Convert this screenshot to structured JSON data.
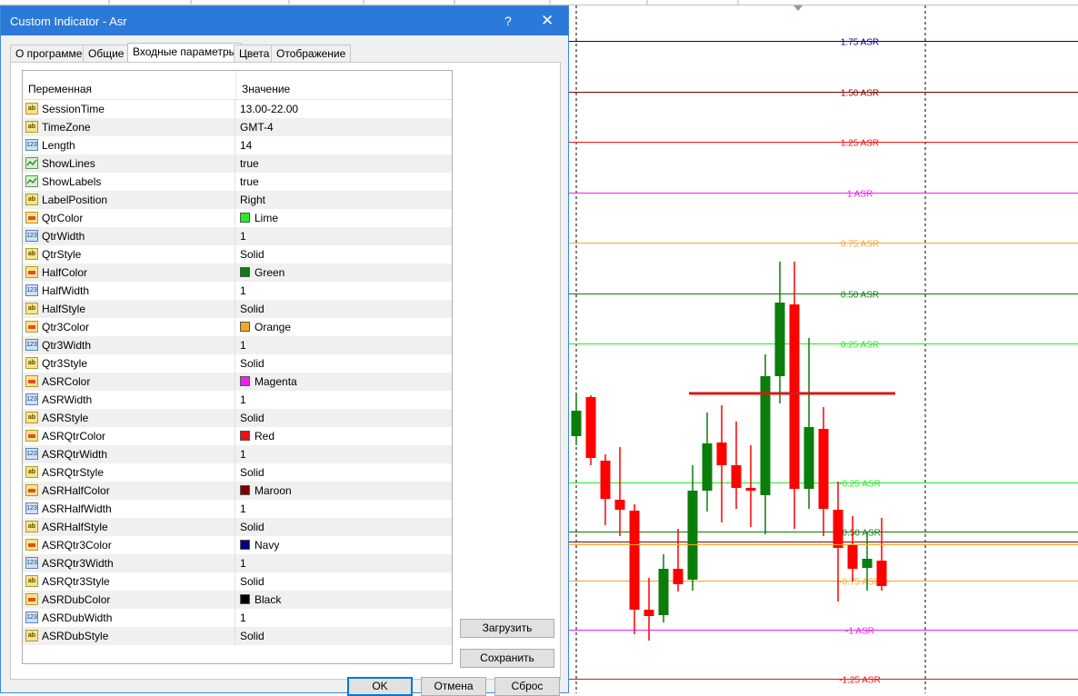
{
  "window": {
    "title": "Custom Indicator - Asr",
    "help_label": "?",
    "close_label": "✕"
  },
  "tabs": [
    {
      "label": "О программе",
      "active": false
    },
    {
      "label": "Общие",
      "active": false
    },
    {
      "label": "Входные параметры",
      "active": true
    },
    {
      "label": "Цвета",
      "active": false
    },
    {
      "label": "Отображение",
      "active": false
    }
  ],
  "params": {
    "columns": {
      "name": "Переменная",
      "value": "Значение"
    },
    "rows": [
      {
        "type": "ab",
        "name": "SessionTime",
        "value": "13.00-22.00"
      },
      {
        "type": "ab",
        "name": "TimeZone",
        "value": "GMT-4"
      },
      {
        "type": "num",
        "name": "Length",
        "value": "14"
      },
      {
        "type": "bool",
        "name": "ShowLines",
        "value": "true"
      },
      {
        "type": "bool",
        "name": "ShowLabels",
        "value": "true"
      },
      {
        "type": "ab",
        "name": "LabelPosition",
        "value": "Right"
      },
      {
        "type": "color",
        "name": "QtrColor",
        "value": "Lime",
        "swatch": "#22ee22"
      },
      {
        "type": "num",
        "name": "QtrWidth",
        "value": "1"
      },
      {
        "type": "ab",
        "name": "QtrStyle",
        "value": "Solid"
      },
      {
        "type": "color",
        "name": "HalfColor",
        "value": "Green",
        "swatch": "#0a7d0a"
      },
      {
        "type": "num",
        "name": "HalfWidth",
        "value": "1"
      },
      {
        "type": "ab",
        "name": "HalfStyle",
        "value": "Solid"
      },
      {
        "type": "color",
        "name": "Qtr3Color",
        "value": "Orange",
        "swatch": "#f5a623"
      },
      {
        "type": "num",
        "name": "Qtr3Width",
        "value": "1"
      },
      {
        "type": "ab",
        "name": "Qtr3Style",
        "value": "Solid"
      },
      {
        "type": "color",
        "name": "ASRColor",
        "value": "Magenta",
        "swatch": "#ee22ee"
      },
      {
        "type": "num",
        "name": "ASRWidth",
        "value": "1"
      },
      {
        "type": "ab",
        "name": "ASRStyle",
        "value": "Solid"
      },
      {
        "type": "color",
        "name": "ASRQtrColor",
        "value": "Red",
        "swatch": "#ee1111"
      },
      {
        "type": "num",
        "name": "ASRQtrWidth",
        "value": "1"
      },
      {
        "type": "ab",
        "name": "ASRQtrStyle",
        "value": "Solid"
      },
      {
        "type": "color",
        "name": "ASRHalfColor",
        "value": "Maroon",
        "swatch": "#800000"
      },
      {
        "type": "num",
        "name": "ASRHalfWidth",
        "value": "1"
      },
      {
        "type": "ab",
        "name": "ASRHalfStyle",
        "value": "Solid"
      },
      {
        "type": "color",
        "name": "ASRQtr3Color",
        "value": "Navy",
        "swatch": "#000080"
      },
      {
        "type": "num",
        "name": "ASRQtr3Width",
        "value": "1"
      },
      {
        "type": "ab",
        "name": "ASRQtr3Style",
        "value": "Solid"
      },
      {
        "type": "color",
        "name": "ASRDubColor",
        "value": "Black",
        "swatch": "#000000"
      },
      {
        "type": "num",
        "name": "ASRDubWidth",
        "value": "1"
      },
      {
        "type": "ab",
        "name": "ASRDubStyle",
        "value": "Solid"
      }
    ]
  },
  "buttons": {
    "load": "Загрузить",
    "save": "Сохранить",
    "ok": "OK",
    "cancel": "Отмена",
    "reset": "Сброс"
  },
  "icon_text": {
    "ab": "ab",
    "num": "123"
  },
  "chart": {
    "levels": [
      {
        "label": "1.75 ASR",
        "color": "#000080"
      },
      {
        "label": "1.50 ASR",
        "color": "#800000"
      },
      {
        "label": "1.25 ASR",
        "color": "#ee1111"
      },
      {
        "label": "1 ASR",
        "color": "#ee22ee"
      },
      {
        "label": "0.75 ASR",
        "color": "#f5a623"
      },
      {
        "label": "0.50 ASR",
        "color": "#0a7d0a"
      },
      {
        "label": "0.25 ASR",
        "color": "#22ee22"
      },
      {
        "label": "-0.25 ASR",
        "color": "#22ee22"
      },
      {
        "label": "-0.50 ASR",
        "color": "#0a7d0a"
      },
      {
        "label": "-0.75 ASR",
        "color": "#f5a623"
      },
      {
        "label": "-1 ASR",
        "color": "#ee22ee"
      },
      {
        "label": "-1.25 ASR",
        "color": "#ee1111"
      }
    ],
    "candle_colors": {
      "up": "#0a7d0a",
      "down": "#ff0000"
    }
  }
}
